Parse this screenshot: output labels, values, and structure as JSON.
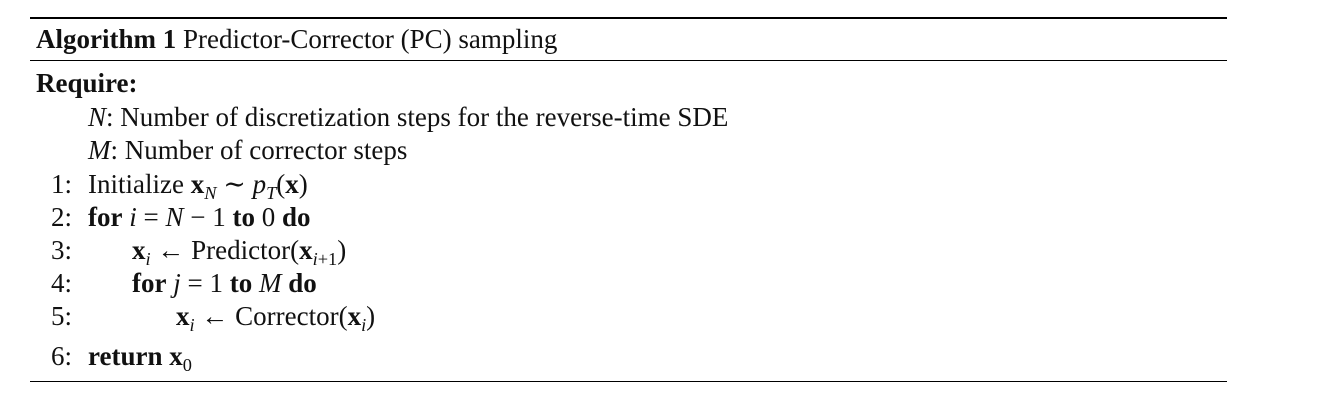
{
  "algorithm": {
    "label": "Algorithm 1",
    "title": "Predictor-Corrector (PC) sampling",
    "require_label": "Require:",
    "requirements": [
      {
        "symbol": "N",
        "description": ": Number of discretization steps for the reverse-time SDE"
      },
      {
        "symbol": "M",
        "description": ": Number of corrector steps"
      }
    ],
    "steps": [
      {
        "number": "1:",
        "text": "Initialize x_N ∼ p_T(x)"
      },
      {
        "number": "2:",
        "text": "for i = N − 1 to 0 do"
      },
      {
        "number": "3:",
        "text": "x_i ← Predictor(x_{i+1})"
      },
      {
        "number": "4:",
        "text": "for j = 1 to M do"
      },
      {
        "number": "5:",
        "text": "x_i ← Corrector(x_i)"
      },
      {
        "number": "6:",
        "text": "return x_0"
      }
    ],
    "tokens": {
      "initialize": "Initialize",
      "for": "for",
      "to": "to",
      "do": "do",
      "return": "return",
      "predictor": "Predictor",
      "corrector": "Corrector"
    }
  }
}
